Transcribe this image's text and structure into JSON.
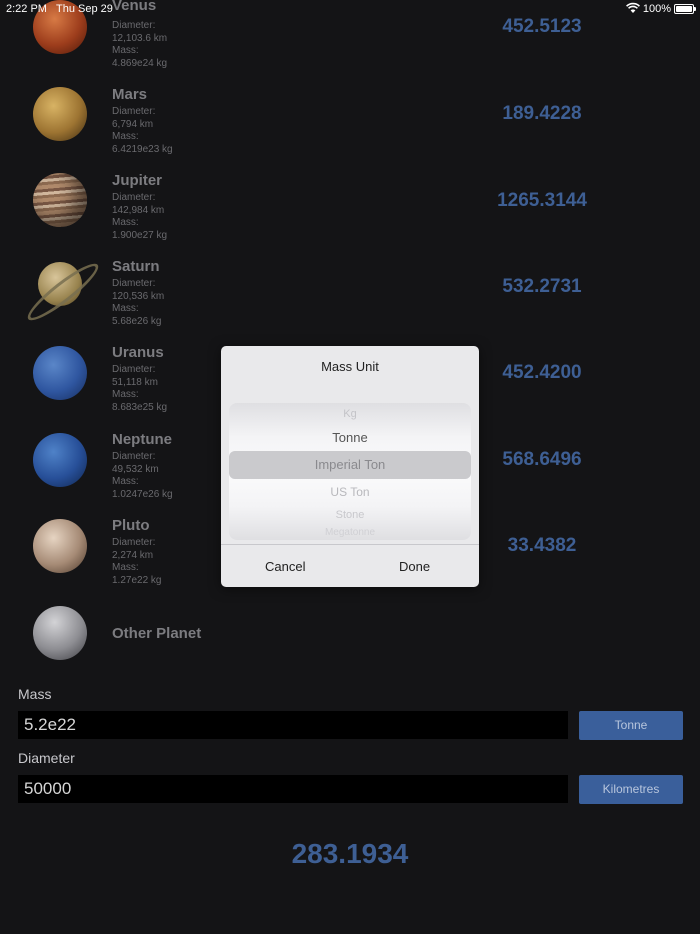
{
  "status_bar": {
    "time": "2:22 PM",
    "date": "Thu Sep 29",
    "battery": "100%"
  },
  "planets": [
    {
      "name": "Venus",
      "diameter_label": "Diameter:",
      "diameter": "12,103.6 km",
      "mass_label": "Mass:",
      "mass": "4.869e24 kg",
      "value": "452.5123"
    },
    {
      "name": "Mars",
      "diameter_label": "Diameter:",
      "diameter": "6,794 km",
      "mass_label": "Mass:",
      "mass": "6.4219e23 kg",
      "value": "189.4228"
    },
    {
      "name": "Jupiter",
      "diameter_label": "Diameter:",
      "diameter": "142,984 km",
      "mass_label": "Mass:",
      "mass": "1.900e27 kg",
      "value": "1265.3144"
    },
    {
      "name": "Saturn",
      "diameter_label": "Diameter:",
      "diameter": "120,536 km",
      "mass_label": "Mass:",
      "mass": "5.68e26 kg",
      "value": "532.2731"
    },
    {
      "name": "Uranus",
      "diameter_label": "Diameter:",
      "diameter": "51,118 km",
      "mass_label": "Mass:",
      "mass": "8.683e25 kg",
      "value": "452.4200"
    },
    {
      "name": "Neptune",
      "diameter_label": "Diameter:",
      "diameter": "49,532 km",
      "mass_label": "Mass:",
      "mass": "1.0247e26 kg",
      "value": "568.6496"
    },
    {
      "name": "Pluto",
      "diameter_label": "Diameter:",
      "diameter": "2,274 km",
      "mass_label": "Mass:",
      "mass": "1.27e22 kg",
      "value": "33.4382"
    }
  ],
  "other_planet": {
    "label": "Other Planet"
  },
  "mass_field": {
    "label": "Mass",
    "value": "5.2e22",
    "unit": "Tonne"
  },
  "diameter_field": {
    "label": "Diameter",
    "value": "50000",
    "unit": "Kilometres"
  },
  "result": "283.1934",
  "dialog": {
    "title": "Mass Unit",
    "options": [
      "Kg",
      "Tonne",
      "Imperial Ton",
      "US Ton",
      "Stone",
      "Megatonne"
    ],
    "selected": "Imperial Ton",
    "cancel": "Cancel",
    "done": "Done"
  },
  "colors": {
    "background": "#141416",
    "accent": "#3e5f94",
    "button": "#3a5f9b"
  }
}
